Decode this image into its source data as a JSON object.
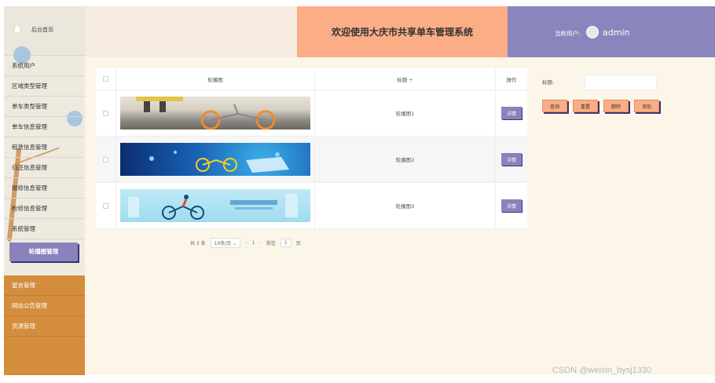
{
  "sidebar": {
    "home_label": "后台首页",
    "items": [
      {
        "label": "系统用户"
      },
      {
        "label": "区域类型管理"
      },
      {
        "label": "单车类型管理"
      },
      {
        "label": "单车信息管理"
      },
      {
        "label": "租赁信息管理"
      },
      {
        "label": "归还信息管理"
      },
      {
        "label": "报修信息管理"
      },
      {
        "label": "检修信息管理"
      },
      {
        "label": "系统管理"
      },
      {
        "label": "轮播图管理"
      },
      {
        "label": "留言管理"
      },
      {
        "label": "网站公告管理"
      },
      {
        "label": "资源管理"
      }
    ]
  },
  "header": {
    "title": "欢迎使用大庆市共享单车管理系统",
    "user_label": "当前用户:",
    "user_name": "admin"
  },
  "table": {
    "columns": [
      "轮播图",
      "标题 ÷",
      "操作"
    ],
    "rows": [
      {
        "title": "轮播图1",
        "action": "详情"
      },
      {
        "title": "轮播图2",
        "action": "详情"
      },
      {
        "title": "轮播图3",
        "action": "详情"
      }
    ]
  },
  "pagination": {
    "total": "共 3 条",
    "page_size": "10条/页 ⌄",
    "prev": "‹",
    "page": "1",
    "next": "›",
    "goto_label": "前往",
    "goto_value": "1",
    "goto_unit": "页"
  },
  "filter": {
    "title_label": "标题:",
    "title_value": "",
    "buttons": [
      "查询",
      "重置",
      "删除",
      "添加"
    ]
  },
  "watermark": "CSDN @weixin_bysj1330",
  "colors": {
    "accent_purple": "#8a83bb",
    "accent_orange": "#fbad86",
    "sidebar_bottom": "#d48d3c",
    "main_bg": "#fcf6e8"
  }
}
